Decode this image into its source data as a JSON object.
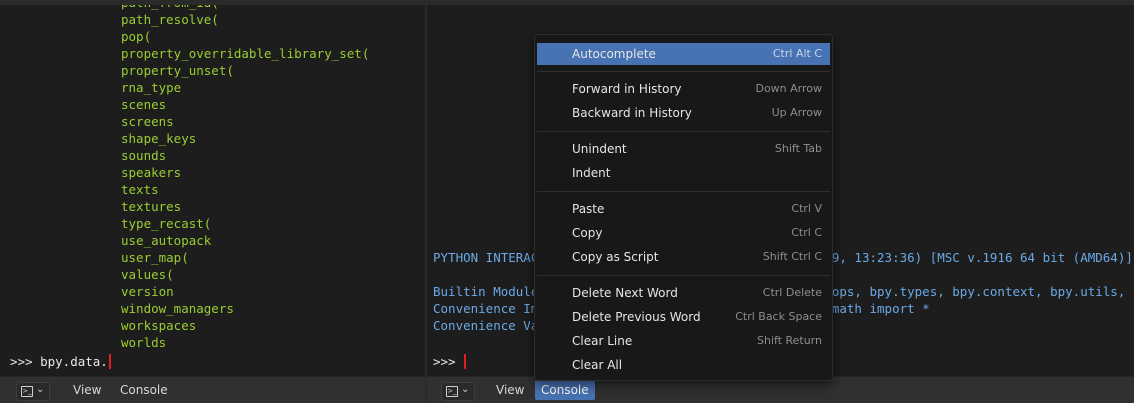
{
  "left_console": {
    "completions": [
      "path_from_id(",
      "path_resolve(",
      "pop(",
      "property_overridable_library_set(",
      "property_unset(",
      "rna_type",
      "scenes",
      "screens",
      "shape_keys",
      "sounds",
      "speakers",
      "texts",
      "textures",
      "type_recast(",
      "use_autopack",
      "user_map(",
      "values(",
      "version",
      "window_managers",
      "workspaces",
      "worlds"
    ],
    "prompt": ">>> bpy.data."
  },
  "right_console": {
    "lines": [
      "PYTHON INTERACTIVE CONSOLE 3.7.4 (default, Aug  1 2019, 13:23:36) [MSC v.1916 64 bit (AMD64)]",
      "",
      "Builtin Modules:       bpy, bpy.data, bpy.ops, bpy.props, bpy.types, bpy.context, bpy.utils, bgl, blf, mathutils",
      "Convenience Imports:   from mathutils import *; from math import *",
      "Convenience Variables: C = bpy.context, D = bpy.data"
    ],
    "prompt": ">>> "
  },
  "left_header": {
    "view": "View",
    "console": "Console"
  },
  "right_header": {
    "view": "View",
    "console": "Console"
  },
  "context_menu": {
    "items": [
      {
        "label": "Autocomplete",
        "shortcut": "Ctrl Alt C"
      },
      {
        "label": "Forward in History",
        "shortcut": "Down Arrow"
      },
      {
        "label": "Backward in History",
        "shortcut": "Up Arrow"
      },
      {
        "label": "Unindent",
        "shortcut": "Shift Tab"
      },
      {
        "label": "Indent",
        "shortcut": ""
      },
      {
        "label": "Paste",
        "shortcut": "Ctrl V"
      },
      {
        "label": "Copy",
        "shortcut": "Ctrl C"
      },
      {
        "label": "Copy as Script",
        "shortcut": "Shift Ctrl C"
      },
      {
        "label": "Delete Next Word",
        "shortcut": "Ctrl Delete"
      },
      {
        "label": "Delete Previous Word",
        "shortcut": "Ctrl Back Space"
      },
      {
        "label": "Clear Line",
        "shortcut": "Shift Return"
      },
      {
        "label": "Clear All",
        "shortcut": ""
      }
    ]
  },
  "colors": {
    "background": "#1d1d1d",
    "completion_text": "#9acd32",
    "info_text": "#6aa9e6",
    "accent": "#4772b3",
    "cursor": "#e02020"
  },
  "icons": [
    "terminal-icon",
    "chevron-down-icon"
  ]
}
